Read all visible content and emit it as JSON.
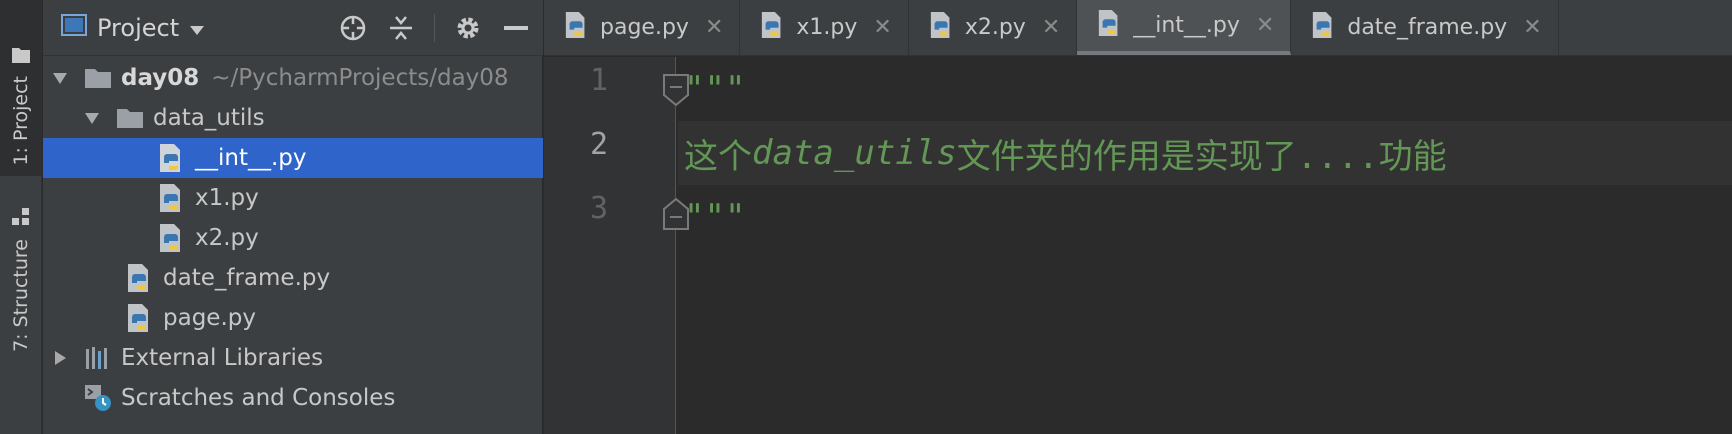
{
  "tool_strip": {
    "project_label": "1: Project",
    "structure_label": "7: Structure"
  },
  "project_panel": {
    "title": "Project",
    "tree": [
      {
        "name": "day08",
        "path": "~/PycharmProjects/day08",
        "type": "folder",
        "expanded": true
      },
      {
        "name": "data_utils",
        "type": "folder",
        "expanded": true
      },
      {
        "name": "__int__.py",
        "type": "python",
        "selected": true
      },
      {
        "name": "x1.py",
        "type": "python"
      },
      {
        "name": "x2.py",
        "type": "python"
      },
      {
        "name": "date_frame.py",
        "type": "python"
      },
      {
        "name": "page.py",
        "type": "python"
      },
      {
        "name": "External Libraries",
        "type": "libraries",
        "expanded": false
      },
      {
        "name": "Scratches and Consoles",
        "type": "scratches"
      }
    ]
  },
  "editor": {
    "tabs": [
      {
        "label": "page.py"
      },
      {
        "label": "x1.py"
      },
      {
        "label": "x2.py"
      },
      {
        "label": "__int__.py",
        "active": true
      },
      {
        "label": "date_frame.py"
      }
    ],
    "line_numbers": [
      "1",
      "2",
      "3"
    ],
    "lines": {
      "l1": "\"\"\"",
      "l2_a": "这个",
      "l2_b": "data_utils",
      "l2_c": "文件夹的作用是实现了....功能",
      "l3": "\"\"\""
    }
  },
  "colors": {
    "selection": "#2f65ca",
    "docstring": "#629755",
    "background": "#2b2b2b",
    "panel": "#3c3f41"
  }
}
